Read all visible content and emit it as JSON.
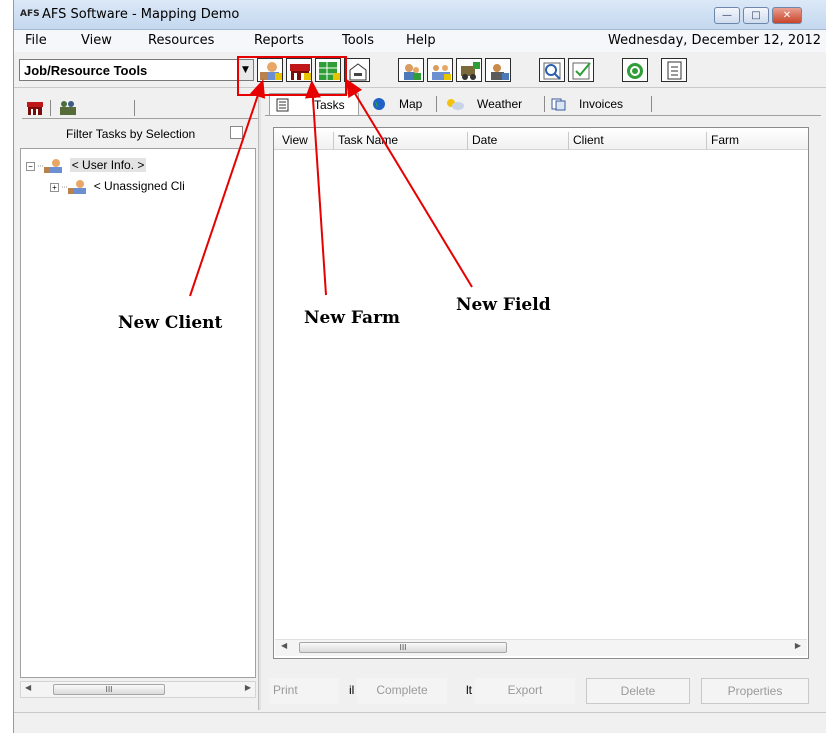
{
  "window": {
    "logo": "AFS",
    "title": "AFS Software - Mapping Demo",
    "minimize_glyph": "—",
    "maximize_glyph": "□",
    "close_glyph": "✕"
  },
  "menu": {
    "items": [
      "File",
      "View",
      "Resources",
      "Reports",
      "Tools",
      "Help"
    ],
    "date": "Wednesday, December 12, 2012"
  },
  "toolbar": {
    "combo_value": "Job/Resource Tools",
    "combo_arrow": "▼",
    "buttons": [
      "new-client-icon",
      "new-farm-icon",
      "new-field-icon",
      "product-icon",
      "users-icon",
      "group-icon",
      "equipment-icon",
      "crew-icon",
      "search-icon",
      "checklist-icon",
      "refresh-icon",
      "document-icon"
    ]
  },
  "left_panel": {
    "tab_icons": [
      "farm-icon",
      "people-icon"
    ],
    "filter_label": "Filter Tasks by Selection",
    "tree": [
      {
        "label": "< User Info. >",
        "expander": "−"
      },
      {
        "label": "< Unassigned Cli",
        "expander": "+"
      }
    ],
    "scroll_thumb": "III",
    "scroll_left": "◀",
    "scroll_right": "▶"
  },
  "right_panel": {
    "tabs": [
      "Tasks",
      "Map",
      "Weather",
      "Invoices"
    ],
    "columns": [
      "View",
      "Task Name",
      "Date",
      "Client",
      "Farm"
    ],
    "scroll_thumb": "III",
    "scroll_left": "◀",
    "scroll_right": "▶",
    "buttons": [
      "Print",
      "Complete",
      "Export",
      "Delete",
      "Properties"
    ],
    "button_fragments": [
      "il",
      "lt"
    ]
  },
  "annotations": {
    "labels": [
      "New Client",
      "New Farm",
      "New Field"
    ],
    "color": "#e60000"
  }
}
